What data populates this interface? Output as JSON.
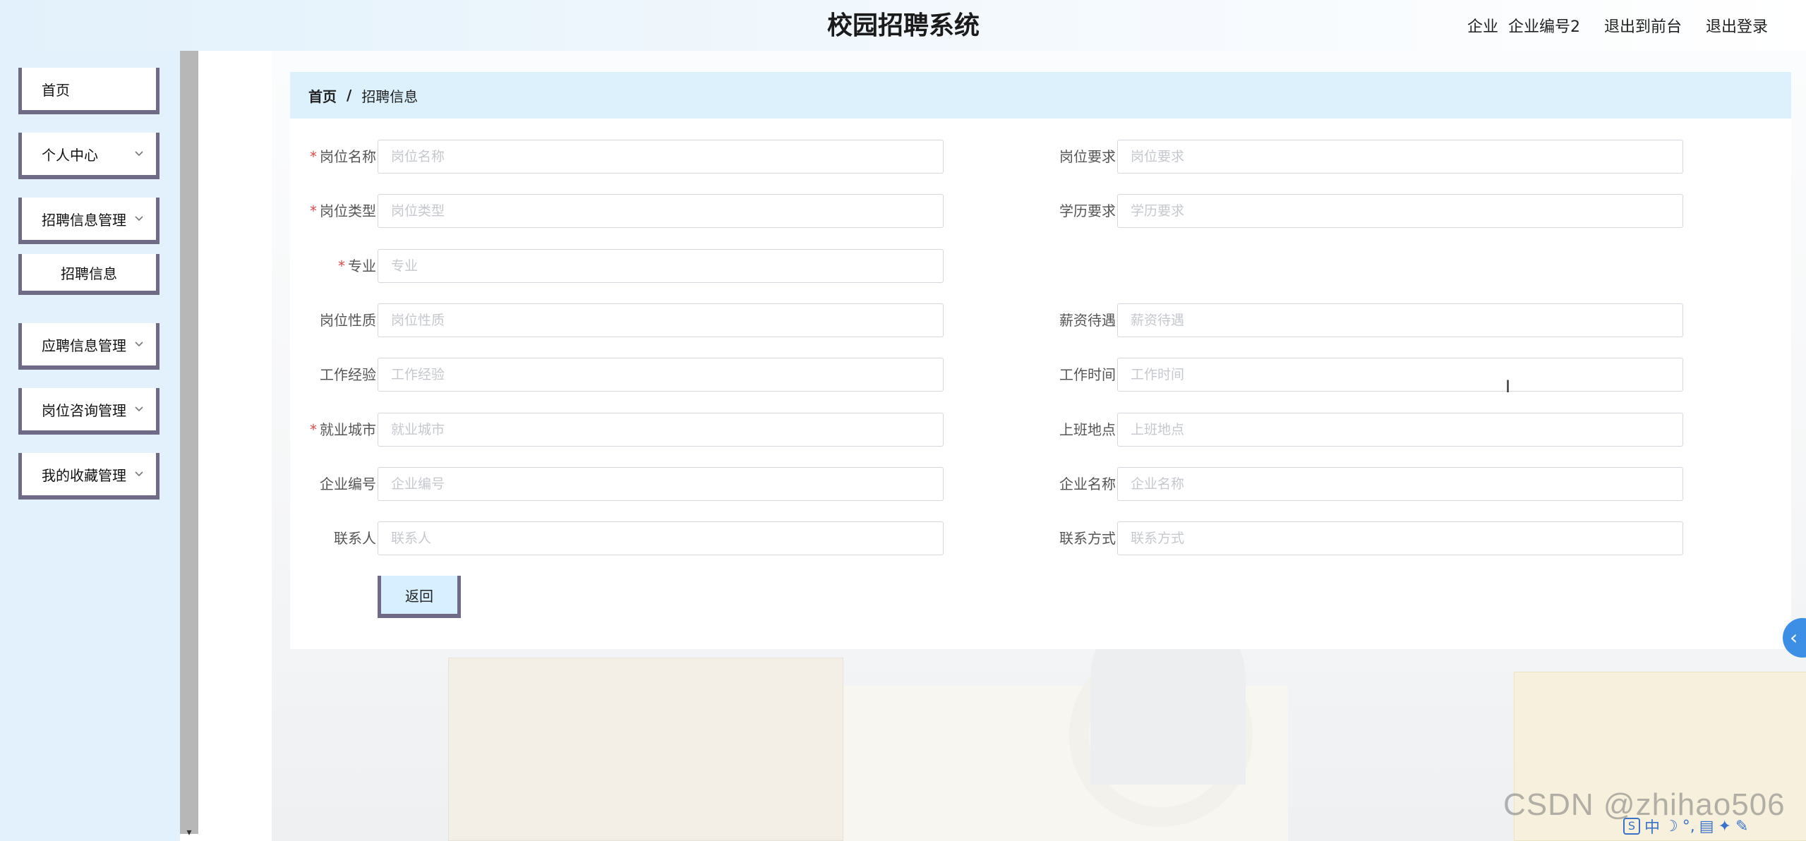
{
  "header": {
    "title": "校园招聘系统",
    "user_role": "企业",
    "user_name": "企业编号2",
    "to_front_label": "退出到前台",
    "logout_label": "退出登录"
  },
  "sidebar": {
    "items": [
      {
        "label": "首页",
        "expandable": false
      },
      {
        "label": "个人中心",
        "expandable": true
      },
      {
        "label": "招聘信息管理",
        "expandable": true
      },
      {
        "label": "招聘信息",
        "expandable": false,
        "submenu": true
      },
      {
        "label": "应聘信息管理",
        "expandable": true
      },
      {
        "label": "岗位咨询管理",
        "expandable": true
      },
      {
        "label": "我的收藏管理",
        "expandable": true
      }
    ]
  },
  "breadcrumb": {
    "home": "首页",
    "separator": "/",
    "current": "招聘信息"
  },
  "form": {
    "fields": [
      {
        "label": "岗位名称",
        "placeholder": "岗位名称",
        "required": true
      },
      {
        "label": "岗位要求",
        "placeholder": "岗位要求",
        "required": false
      },
      {
        "label": "岗位类型",
        "placeholder": "岗位类型",
        "required": true
      },
      {
        "label": "学历要求",
        "placeholder": "学历要求",
        "required": false
      },
      {
        "label": "专业",
        "placeholder": "专业",
        "required": true
      },
      {
        "label": "岗位性质",
        "placeholder": "岗位性质",
        "required": false
      },
      {
        "label": "薪资待遇",
        "placeholder": "薪资待遇",
        "required": false
      },
      {
        "label": "工作经验",
        "placeholder": "工作经验",
        "required": false
      },
      {
        "label": "工作时间",
        "placeholder": "工作时间",
        "required": false
      },
      {
        "label": "就业城市",
        "placeholder": "就业城市",
        "required": true
      },
      {
        "label": "上班地点",
        "placeholder": "上班地点",
        "required": false
      },
      {
        "label": "企业编号",
        "placeholder": "企业编号",
        "required": false
      },
      {
        "label": "企业名称",
        "placeholder": "企业名称",
        "required": false
      },
      {
        "label": "联系人",
        "placeholder": "联系人",
        "required": false
      },
      {
        "label": "联系方式",
        "placeholder": "联系方式",
        "required": false
      }
    ],
    "required_mark": "*",
    "back_label": "返回"
  },
  "overlay": {
    "watermark": "CSDN @zhihao506",
    "ime_mode": "中",
    "collapse_glyph": "‹"
  },
  "colors": {
    "header_bg": "#e2f1fb",
    "sidebar_bg": "#e2f1fb",
    "breadcrumb_bg": "#dcf1fc",
    "menu_border": "#6f6a86",
    "required": "#e24a4a",
    "collapse_btn": "#3d8fe6"
  }
}
